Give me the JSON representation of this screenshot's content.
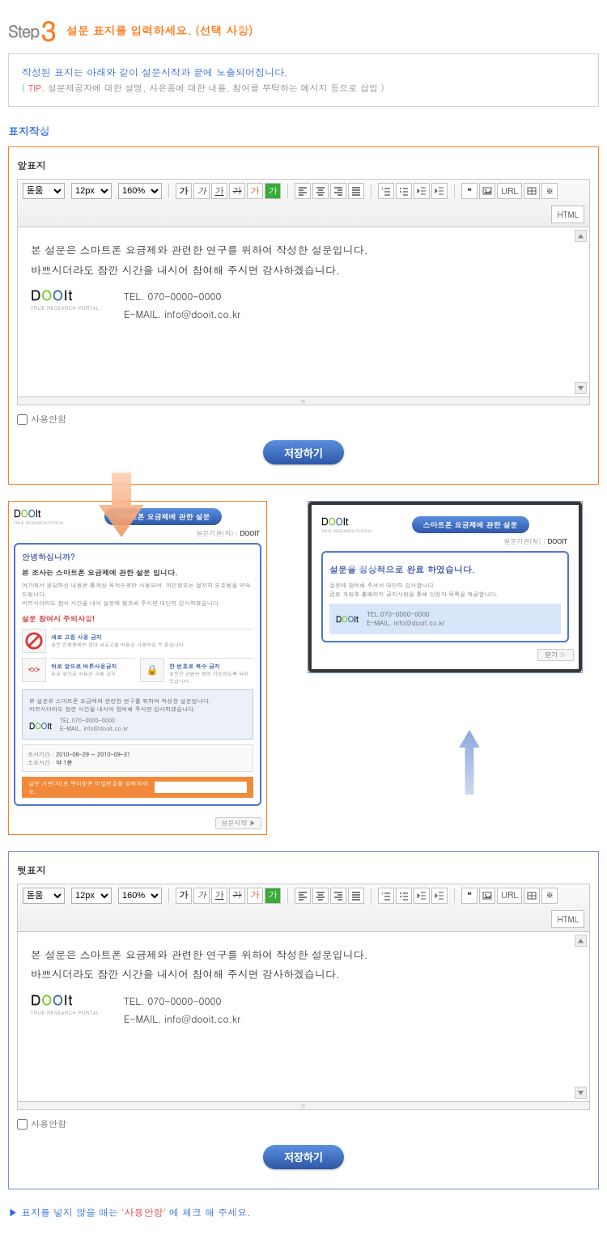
{
  "step": {
    "prefix": "Step",
    "num": "3",
    "title": "설문 표지를 입력하세요. (선택 사항)"
  },
  "info": {
    "main": "작성된 표지는 아래와 같이 설문시작과 끝에 노출되어집니다.",
    "sub_open": "( ",
    "sub_tip": "TIP.",
    "sub_text": " 설문제공자에 대한 설명, 사은품에 대한 내용, 참여를 부탁하는 메시지 등으로 삽입 )"
  },
  "section_heading": "표지작성",
  "toolbar": {
    "font": "돋움",
    "size": "12px",
    "line": "160%",
    "ga": "가",
    "url": "URL",
    "html": "HTML"
  },
  "front": {
    "title": "앞표지",
    "body_line1": "본 설문은 스마트폰 요금제와 관련한 연구를 위하여 작성한 설문입니다.",
    "body_line2": "바쁘시더라도 잠깐 시간을 내시어 참여해 주시면 감사하겠습니다.",
    "logo_sub": "TRUE RESEARCH PORTAL",
    "tel": "TEL. 070-0000-0000",
    "email": "E-MAIL. info@dooit.co.kr",
    "disable": "사용안함",
    "save": "저장하기"
  },
  "back": {
    "title": "뒷표지",
    "body_line1": "본 설문은 스마트폰 요금제와 관련한 연구를 위하여 작성한 설문입니다.",
    "body_line2": "바쁘시더라도 잠깐 시간을 내시어 참여해 주시면 감사하겠습니다.",
    "logo_sub": "TRUE RESEARCH PORTAL",
    "tel": "TEL. 070-0000-0000",
    "email": "E-MAIL. info@dooit.co.kr",
    "disable": "사용안함",
    "save": "저장하기"
  },
  "preview_front": {
    "pill": "스마트폰 요금제에 관한 설문",
    "meta_label": "설문기관(자) :",
    "meta_value": "DOOIT",
    "hello": "안녕하십니까?",
    "h": "본 조사는 스마트폰 요금제에 관한 설문 입니다.",
    "text1": "여기에서 응답하신 내용은 통계상 목적으로만 사용되며, 개인정보는 철저히 보호됨을 약속드립니다.",
    "text2": "바쁘시더라도 잠시 시간을 내어 설문에 협조해 주시면 대단히 감사하겠습니다.",
    "sub": "설문 참여시 주의사항!",
    "rule1_t": "새로 고침 사용 금지",
    "rule1_d": "설문 진행중에는 절대 새로고침 버튼을 사용하실 수 없습니다.",
    "rule2_t": "뒤로 앞으로 버튼사용금지",
    "rule2_d": "뒤로 앞으로 버튼은 사용 금지",
    "rule3_t": "한 번호로 복수 금지",
    "rule3_d": "설문은 한번만 참여 가능하도록 되어 있습니다.",
    "key_l1": "본 설문은 스마트폰 요금제와 관련한 연구를 위하여 작성한 설문입니다.",
    "key_l2": "바쁘시더라도 잠깐 시간을 내시어 참여해 주시면 감사하겠습니다.",
    "key_tel": "TEL.070-0000-0000",
    "key_mail": "E-MAIL. info@dooit.co.kr",
    "date_label": "조사기간 : ",
    "date_value": "2010-08-29 ~ 2010-09-31",
    "time_label": "소요시간 : ",
    "time_value": "약 1분",
    "footer_label": "설문 기관(자)로 부터받은 비밀번호를 입력하세요.",
    "nav": "설문시작 ▶"
  },
  "preview_back": {
    "pill": "스마트폰 요금제에 관한 설문",
    "meta_label": "설문기관(자) :",
    "meta_value": "DOOIT",
    "hd": "설문을 정상적으로 완료 하였습니다.",
    "l1": "설문에 참여해 주셔서 대단히 감사합니다.",
    "l2": "검토 과정후 홈페이지 공지사항을 통해 당첨자 목록을 제공합니다.",
    "tel": "TEL.070-0000-0000",
    "mail": "E-MAIL. info@dooit.co.kr",
    "close": "닫기 ▷"
  },
  "footer": {
    "pre": "▶ 표지를 넣지 않을 때는   ",
    "red": "'사용안함'",
    "post": "  에 체크 해 주세요."
  }
}
